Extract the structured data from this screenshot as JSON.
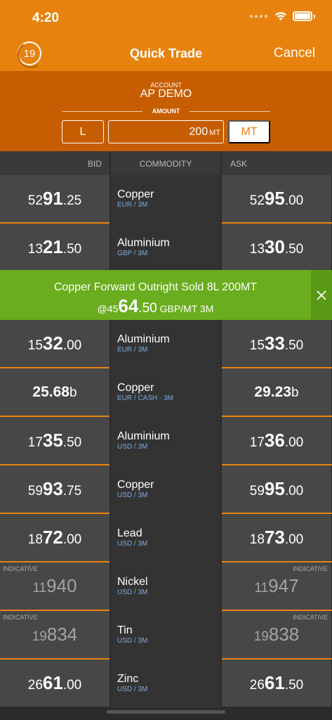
{
  "status": {
    "time": "4:20"
  },
  "nav": {
    "timer": "19",
    "title": "Quick Trade",
    "cancel": "Cancel"
  },
  "account": {
    "label": "ACCOUNT",
    "value": "AP DEMO",
    "amount_label": "AMOUNT",
    "lots_label": "L",
    "amount_value": "200",
    "amount_unit": "MT",
    "unit_button": "MT"
  },
  "columns": {
    "bid": "BID",
    "commodity": "COMMODITY",
    "ask": "ASK"
  },
  "rows": [
    {
      "name": "Copper",
      "sub": "EUR / 3M",
      "bid": {
        "pre": "52",
        "big": "91",
        "post": ".25"
      },
      "ask": {
        "pre": "52",
        "big": "95",
        "post": ".00"
      }
    },
    {
      "name": "Aluminium",
      "sub": "GBP / 3M",
      "bid": {
        "pre": "13",
        "big": "21",
        "post": ".50"
      },
      "ask": {
        "pre": "13",
        "big": "30",
        "post": ".50"
      }
    },
    {
      "name": "Aluminium",
      "sub": "EUR / 3M",
      "bid": {
        "pre": "15",
        "big": "32",
        "post": ".00"
      },
      "ask": {
        "pre": "15",
        "big": "33",
        "post": ".50"
      }
    },
    {
      "name": "Copper",
      "sub": "EUR / CASH - 3M",
      "bid": {
        "pre": "",
        "big": "25.68",
        "post": "b"
      },
      "ask": {
        "pre": "",
        "big": "29.23",
        "post": "b"
      }
    },
    {
      "name": "Aluminium",
      "sub": "USD / 3M",
      "bid": {
        "pre": "17",
        "big": "35",
        "post": ".50"
      },
      "ask": {
        "pre": "17",
        "big": "36",
        "post": ".00"
      }
    },
    {
      "name": "Copper",
      "sub": "USD / 3M",
      "bid": {
        "pre": "59",
        "big": "93",
        "post": ".75"
      },
      "ask": {
        "pre": "59",
        "big": "95",
        "post": ".00"
      }
    },
    {
      "name": "Lead",
      "sub": "USD / 3M",
      "bid": {
        "pre": "18",
        "big": "72",
        "post": ".00"
      },
      "ask": {
        "pre": "18",
        "big": "73",
        "post": ".00"
      }
    },
    {
      "name": "Nickel",
      "sub": "USD / 3M",
      "indicative": "INDICATIVE",
      "bid": {
        "pre": "11",
        "big": "940",
        "post": ""
      },
      "ask": {
        "pre": "11",
        "big": "947",
        "post": ""
      }
    },
    {
      "name": "Tin",
      "sub": "USD / 3M",
      "indicative": "INDICATIVE",
      "bid": {
        "pre": "19",
        "big": "834",
        "post": ""
      },
      "ask": {
        "pre": "19",
        "big": "838",
        "post": ""
      }
    },
    {
      "name": "Zinc",
      "sub": "USD / 3M",
      "bid": {
        "pre": "26",
        "big": "61",
        "post": ".00"
      },
      "ask": {
        "pre": "26",
        "big": "61",
        "post": ".50"
      }
    }
  ],
  "toast": {
    "message": "Copper Forward Outright Sold 8L 200MT",
    "price_prefix": "@45",
    "price_big": "64",
    "price_post": ".50",
    "price_suffix": " GBP/MT 3M"
  },
  "colors": {
    "accent": "#e8820e",
    "panel": "#c65d00",
    "success": "#6aad1e"
  },
  "icons": {
    "close": "close-icon",
    "wifi": "wifi-icon",
    "battery": "battery-icon"
  }
}
